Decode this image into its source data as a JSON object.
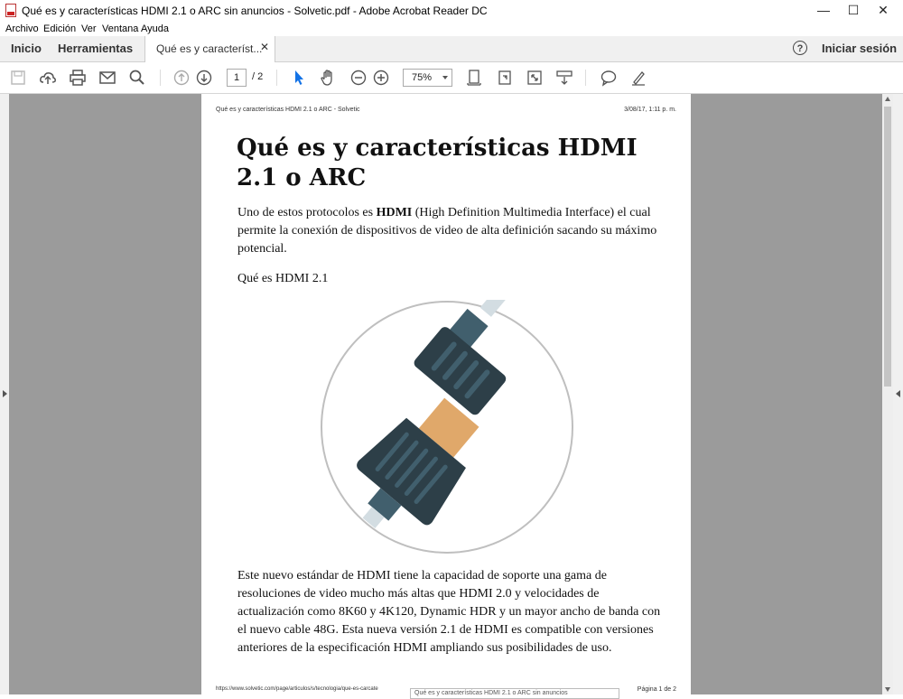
{
  "window": {
    "title": "Qué es y características HDMI 2.1 o ARC sin anuncios - Solvetic.pdf - Adobe Acrobat Reader DC",
    "minimize": "—",
    "maximize": "☐",
    "close": "✕"
  },
  "menu": [
    "Archivo",
    "Edición",
    "Ver",
    "Ventana",
    "Ayuda"
  ],
  "nav": {
    "home": "Inicio",
    "tools": "Herramientas",
    "doc_tab": "Qué es y característ...",
    "tab_close": "✕",
    "help": "?",
    "signin": "Iniciar sesión"
  },
  "toolbar": {
    "page_current": "1",
    "page_total": "/ 2",
    "zoom": "75%"
  },
  "document": {
    "header_left": "Qué es y características HDMI 2.1 o ARC - Solvetic",
    "header_right": "3/08/17, 1:11 p. m.",
    "title": "Qué es y características HDMI 2.1 o ARC",
    "intro_prefix": "Uno de estos protocolos es ",
    "intro_bold": "HDMI",
    "intro_suffix": " (High Definition Multimedia Interface) el cual permite la conexión de dispositivos de video de alta definición sacando su máximo potencial.",
    "subheading": "Qué es HDMI 2.1",
    "body": "Este nuevo estándar de HDMI tiene la capacidad de soporte una gama de resoluciones de video mucho más altas que HDMI 2.0 y velocidades de actualización como 8K60 y 4K120, Dynamic HDR y un mayor ancho de banda con el nuevo cable 48G. Esta nueva versión 2.1 de HDMI es compatible con versiones anteriores de la especificación HDMI ampliando sus posibilidades de uso.",
    "footer_left": "https://www.solvetic.com/page/articulos/s/tecnologia/que-es-carcate",
    "footer_right": "Página 1 de 2",
    "tooltip": "Qué es y características HDMI 2.1 o ARC sin anuncios"
  },
  "colors": {
    "connector_dark": "#2d3f48",
    "connector_light": "#415f6d",
    "plug_gold": "#e0a86a",
    "workspace_bg": "#9b9b9b",
    "select_tool": "#1473e6"
  }
}
